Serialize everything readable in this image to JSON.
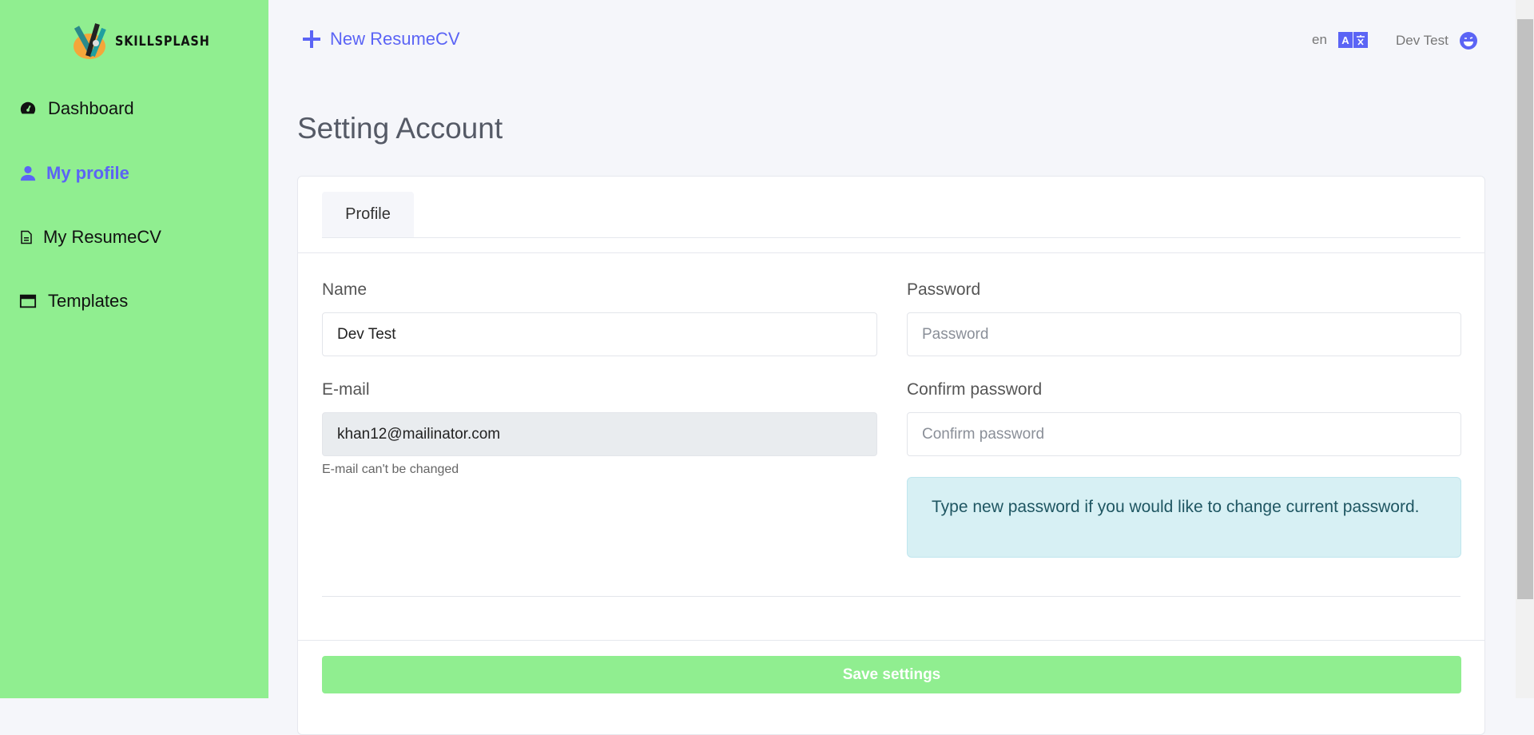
{
  "brand": {
    "name": "SKILLSPLASH"
  },
  "sidebar": {
    "items": [
      {
        "label": "Dashboard",
        "icon": "gauge-icon",
        "active": false
      },
      {
        "label": "My profile",
        "icon": "user-icon",
        "active": true
      },
      {
        "label": "My ResumeCV",
        "icon": "file-icon",
        "active": false
      },
      {
        "label": "Templates",
        "icon": "window-icon",
        "active": false
      }
    ]
  },
  "topbar": {
    "new_label": "New ResumeCV",
    "lang": "en",
    "user": "Dev Test"
  },
  "page": {
    "title": "Setting Account",
    "tab": "Profile"
  },
  "form": {
    "name_label": "Name",
    "name_value": "Dev Test",
    "email_label": "E-mail",
    "email_value": "khan12@mailinator.com",
    "email_hint": "E-mail can't be changed",
    "password_label": "Password",
    "password_placeholder": "Password",
    "confirm_label": "Confirm password",
    "confirm_placeholder": "Confirm password",
    "info": "Type new password if you would like to change current password.",
    "save_label": "Save settings"
  },
  "colors": {
    "sidebar": "#90ee90",
    "accent": "#5b64f5",
    "info_bg": "#d7f0f4"
  }
}
